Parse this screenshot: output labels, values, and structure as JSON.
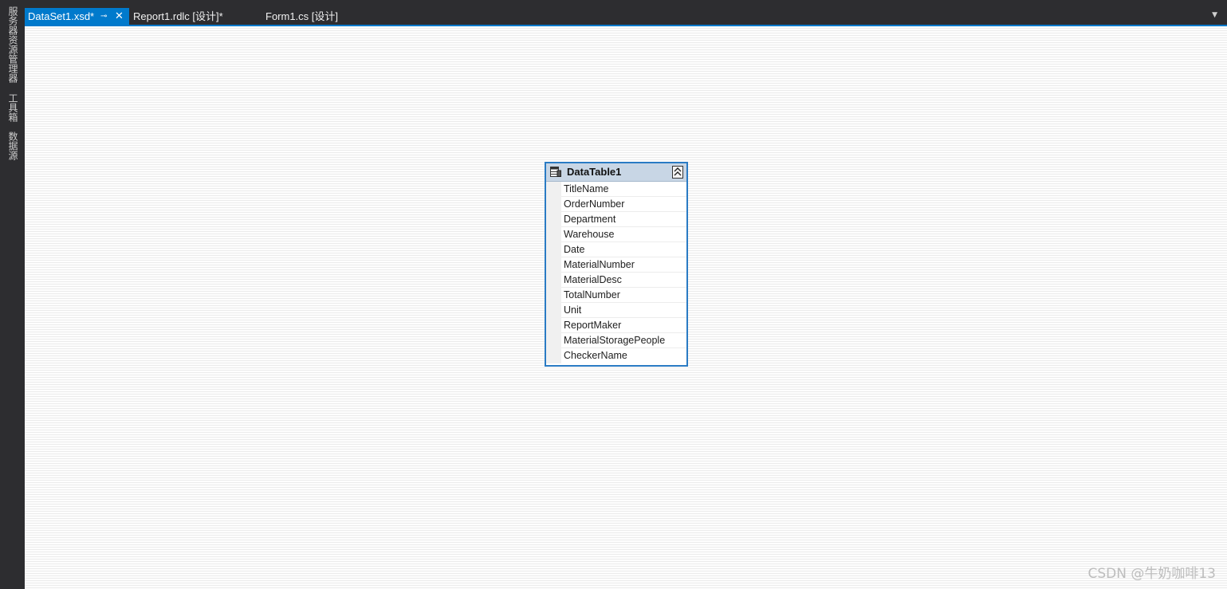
{
  "side_strip": {
    "items": [
      "服务器资源管理器",
      "工具箱",
      "数据源"
    ]
  },
  "tabs": [
    {
      "label": "DataSet1.xsd*",
      "active": true
    },
    {
      "label": "Report1.rdlc [设计]*",
      "active": false
    },
    {
      "label": "Form1.cs [设计]",
      "active": false
    }
  ],
  "tab_icons": {
    "pin": "⊸",
    "close": "✕",
    "dropdown": "▼"
  },
  "datatable": {
    "title": "DataTable1",
    "collapse_glyph": "︽",
    "columns": [
      "TitleName",
      "OrderNumber",
      "Department",
      "Warehouse",
      "Date",
      "MaterialNumber",
      "MaterialDesc",
      "TotalNumber",
      "Unit",
      "ReportMaker",
      "MaterialStoragePeople",
      "CheckerName"
    ]
  },
  "watermark": "CSDN @牛奶咖啡13",
  "colors": {
    "accent": "#007acc",
    "chrome": "#2d2d30",
    "table_border": "#2a7bc4",
    "table_header": "#c8d6e5"
  }
}
